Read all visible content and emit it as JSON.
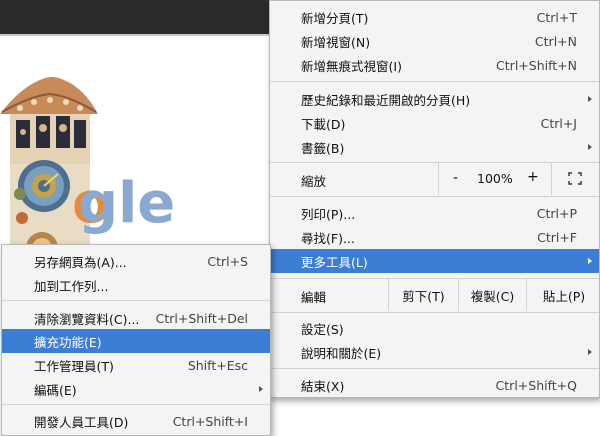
{
  "main_menu": {
    "items": [
      {
        "label": "新增分頁(T)",
        "shortcut": "Ctrl+T"
      },
      {
        "label": "新增視窗(N)",
        "shortcut": "Ctrl+N"
      },
      {
        "label": "新增無痕式視窗(I)",
        "shortcut": "Ctrl+Shift+N"
      },
      {
        "label": "歷史紀錄和最近開啟的分頁(H)",
        "shortcut": ""
      },
      {
        "label": "下載(D)",
        "shortcut": "Ctrl+J"
      },
      {
        "label": "書籤(B)",
        "shortcut": ""
      },
      {
        "label": "列印(P)...",
        "shortcut": "Ctrl+P"
      },
      {
        "label": "尋找(F)...",
        "shortcut": "Ctrl+F"
      },
      {
        "label": "更多工具(L)",
        "shortcut": ""
      },
      {
        "label": "設定(S)",
        "shortcut": ""
      },
      {
        "label": "說明和關於(E)",
        "shortcut": ""
      },
      {
        "label": "結束(X)",
        "shortcut": "Ctrl+Shift+Q"
      }
    ],
    "zoom": {
      "label": "縮放",
      "minus": "-",
      "value": "100%",
      "plus": "+"
    },
    "edit": {
      "label": "編輯",
      "cut": "剪下(T)",
      "copy": "複製(C)",
      "paste": "貼上(P)"
    }
  },
  "sub_menu": {
    "items": [
      {
        "label": "另存網頁為(A)...",
        "shortcut": "Ctrl+S"
      },
      {
        "label": "加到工作列...",
        "shortcut": ""
      },
      {
        "label": "清除瀏覽資料(C)...",
        "shortcut": "Ctrl+Shift+Del"
      },
      {
        "label": "擴充功能(E)",
        "shortcut": ""
      },
      {
        "label": "工作管理員(T)",
        "shortcut": "Shift+Esc"
      },
      {
        "label": "編碼(E)",
        "shortcut": ""
      },
      {
        "label": "開發人員工具(D)",
        "shortcut": "Ctrl+Shift+I"
      }
    ]
  },
  "doodle_text": "gle",
  "colors": {
    "highlight": "#3c7ed6",
    "menu_bg": "#f4f4f4",
    "topbar": "#2b2b2b"
  }
}
